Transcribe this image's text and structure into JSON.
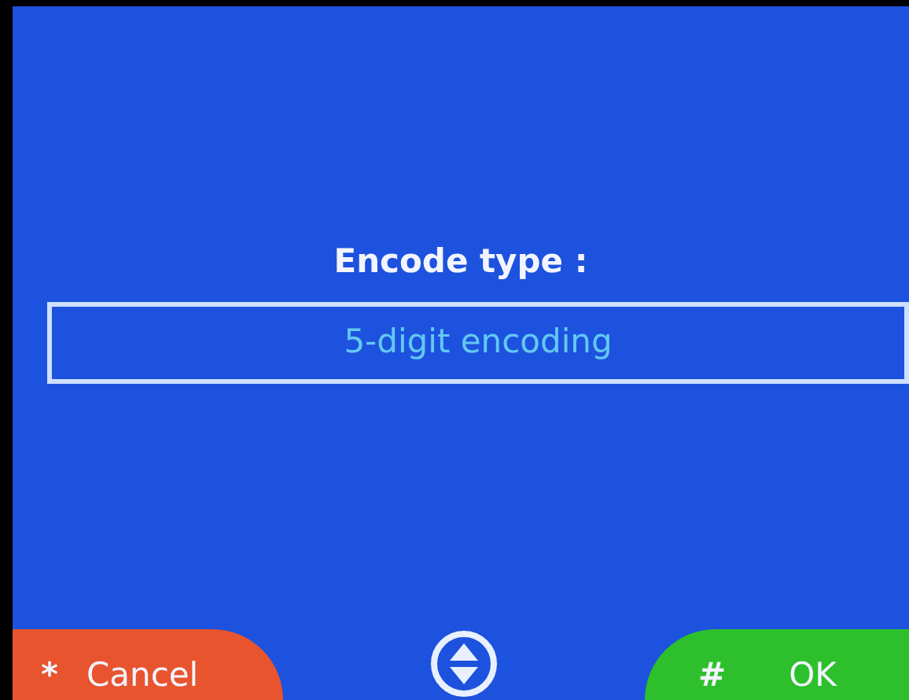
{
  "prompt": {
    "label": "Encode type :"
  },
  "field": {
    "value": "5-digit encoding"
  },
  "softkeys": [
    {
      "kind": "cancel",
      "key": "*",
      "label": "Cancel"
    },
    {
      "kind": "ok",
      "key": "#",
      "label": "OK"
    }
  ]
}
